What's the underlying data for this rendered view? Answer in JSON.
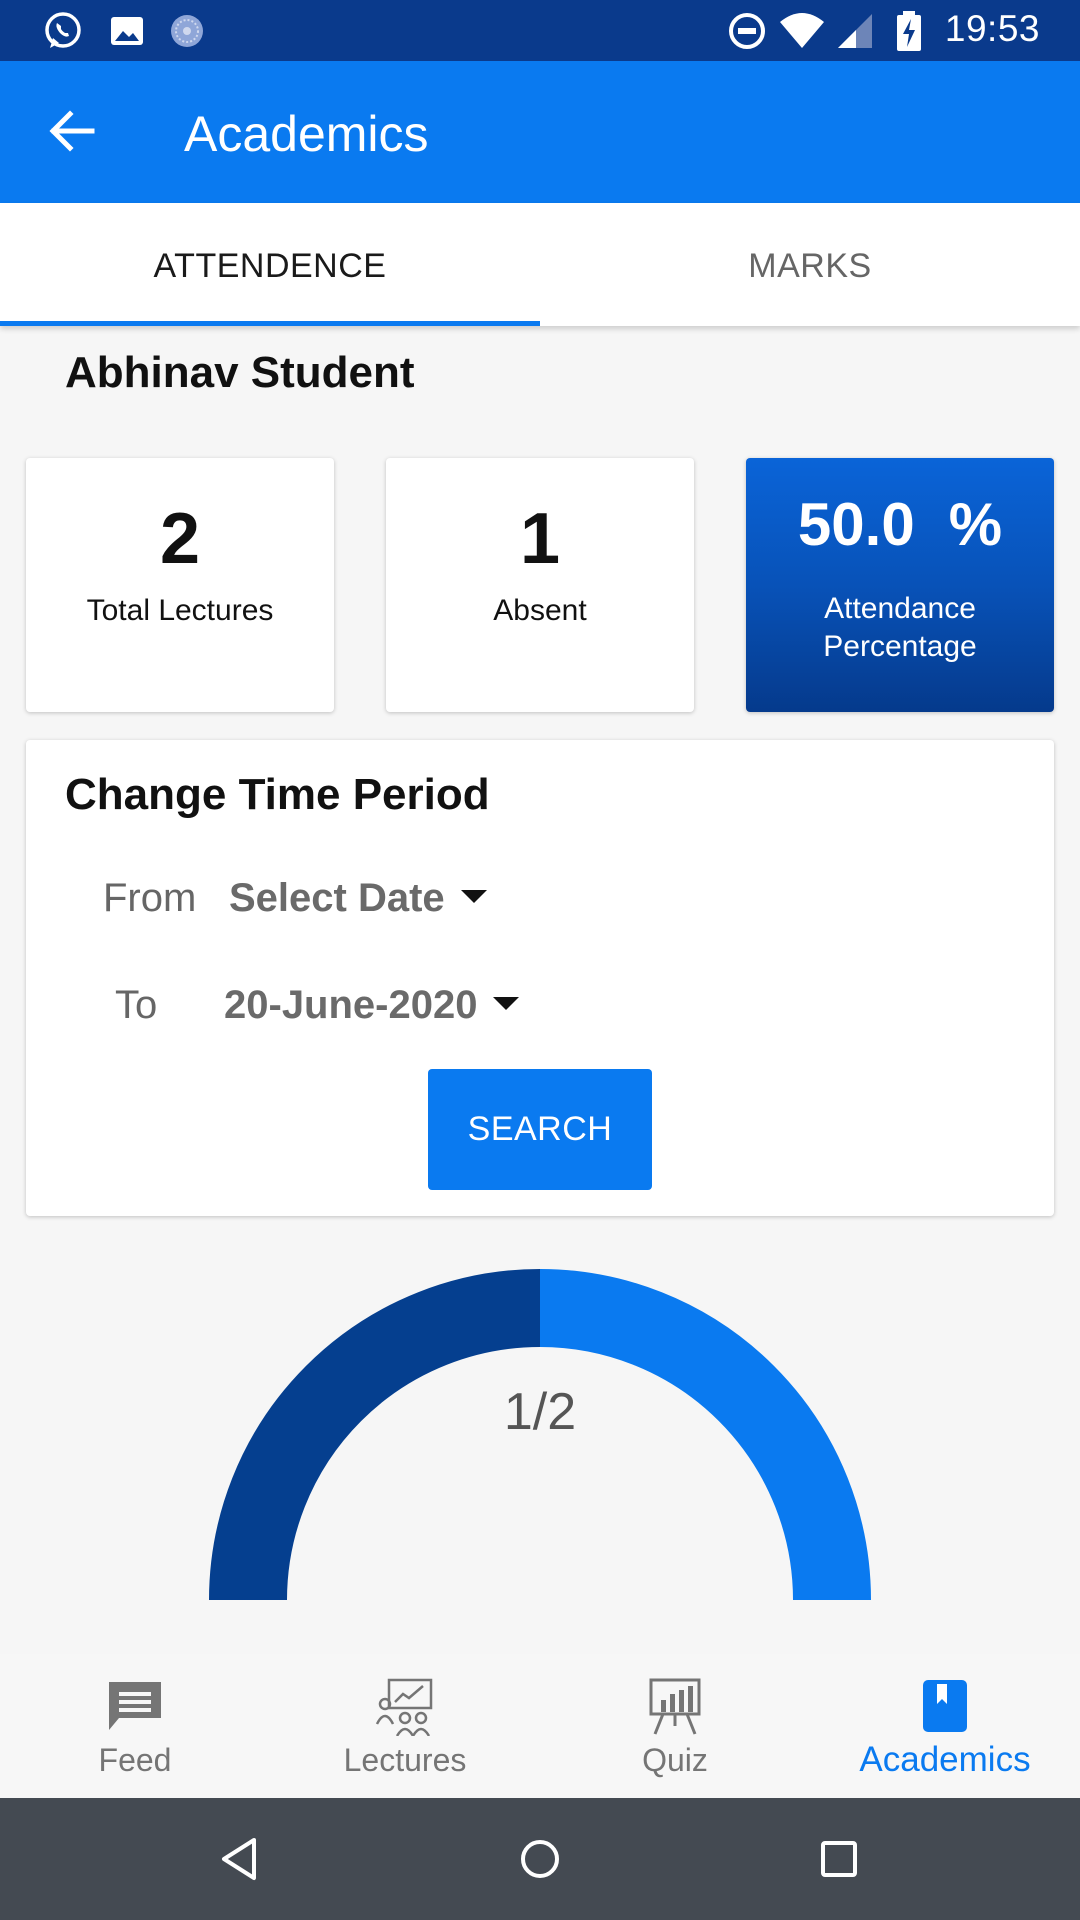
{
  "status_bar": {
    "time": "19:53",
    "left_icons": [
      "whatsapp-icon",
      "image-icon",
      "app-notification-icon"
    ],
    "right_icons": [
      "do-not-disturb-icon",
      "wifi-icon",
      "signal-icon",
      "battery-charging-icon"
    ]
  },
  "app_bar": {
    "title": "Academics",
    "back_icon": "arrow-left-icon"
  },
  "tabs": [
    {
      "label": "ATTENDENCE",
      "selected": true
    },
    {
      "label": "MARKS",
      "selected": false
    }
  ],
  "student": {
    "name": "Abhinav Student"
  },
  "stats": {
    "total_lectures": {
      "value": "2",
      "label": "Total Lectures"
    },
    "absent": {
      "value": "1",
      "label": "Absent"
    },
    "attendance": {
      "value": "50.0",
      "unit": "%",
      "label": "Attendance Percentage"
    }
  },
  "time_period": {
    "title": "Change Time Period",
    "from_label": "From",
    "from_value": "Select Date",
    "to_label": "To",
    "to_value": "20-June-2020",
    "search_label": "SEARCH"
  },
  "gauge": {
    "label": "1/2",
    "fraction": 0.5,
    "colors": {
      "filled": "#053f8f",
      "remaining": "#0a7af0"
    }
  },
  "bottom_nav": {
    "items": [
      {
        "label": "Feed",
        "icon": "message-icon",
        "active": false
      },
      {
        "label": "Lectures",
        "icon": "presentation-icon",
        "active": false
      },
      {
        "label": "Quiz",
        "icon": "chart-board-icon",
        "active": false
      },
      {
        "label": "Academics",
        "icon": "bookmark-book-icon",
        "active": true
      }
    ]
  },
  "system_nav": {
    "buttons": [
      "back-triangle-icon",
      "home-circle-icon",
      "recents-square-icon"
    ]
  },
  "colors": {
    "primary": "#0a7af0",
    "status_bar": "#0a3a8c",
    "dark_blue": "#053a8c",
    "system_nav": "#444a52"
  }
}
